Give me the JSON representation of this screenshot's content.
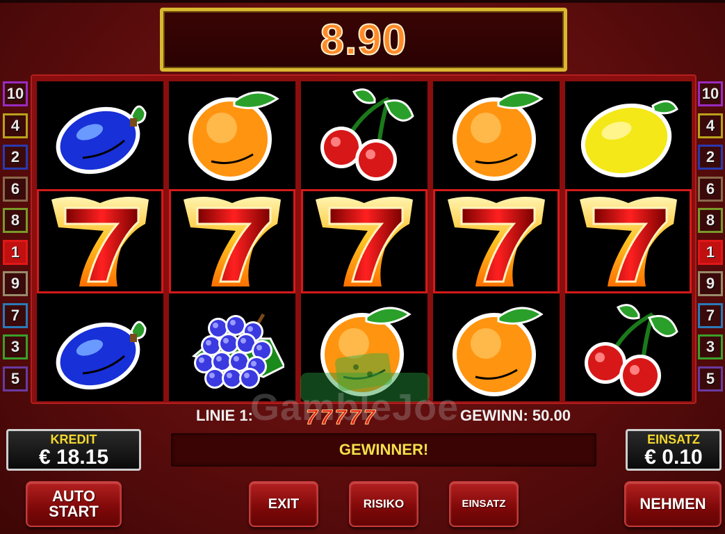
{
  "win_display": {
    "amount": "8.90"
  },
  "lines_left": [
    {
      "n": "10",
      "color": "#9b2ac0"
    },
    {
      "n": "4",
      "color": "#b8a21a"
    },
    {
      "n": "2",
      "color": "#2a3ab0"
    },
    {
      "n": "6",
      "color": "#8a6a4a"
    },
    {
      "n": "8",
      "color": "#7a9a2a"
    },
    {
      "n": "1",
      "color": "#e01818"
    },
    {
      "n": "9",
      "color": "#9a8a6a"
    },
    {
      "n": "7",
      "color": "#2a7ab8"
    },
    {
      "n": "3",
      "color": "#3aa02a"
    },
    {
      "n": "5",
      "color": "#6a3aa0"
    }
  ],
  "lines_right": [
    {
      "n": "10",
      "color": "#9b2ac0"
    },
    {
      "n": "4",
      "color": "#b8a21a"
    },
    {
      "n": "2",
      "color": "#2a3ab0"
    },
    {
      "n": "6",
      "color": "#8a6a4a"
    },
    {
      "n": "8",
      "color": "#7a9a2a"
    },
    {
      "n": "1",
      "color": "#e01818"
    },
    {
      "n": "9",
      "color": "#9a8a6a"
    },
    {
      "n": "7",
      "color": "#2a7ab8"
    },
    {
      "n": "3",
      "color": "#3aa02a"
    },
    {
      "n": "5",
      "color": "#6a3aa0"
    }
  ],
  "reels": [
    [
      "plum-icon",
      "seven-icon",
      "plum-icon"
    ],
    [
      "orange-icon",
      "seven-icon",
      "grapes-icon"
    ],
    [
      "cherry-icon",
      "seven-icon",
      "orange-icon"
    ],
    [
      "orange-icon",
      "seven-icon",
      "orange-icon"
    ],
    [
      "lemon-icon",
      "seven-icon",
      "cherry-icon"
    ]
  ],
  "info": {
    "linie": "LINIE 1:",
    "gewinn": "GEWINN: 50.00",
    "sevens": [
      "7",
      "7",
      "7",
      "7",
      "7"
    ]
  },
  "watermark": "GambleJoe",
  "message": "GEWINNER!",
  "kredit": {
    "label": "KREDIT",
    "value": "€ 18.15"
  },
  "einsatz": {
    "label": "EINSATZ",
    "value": "€ 0.10"
  },
  "buttons": {
    "auto_line1": "AUTO",
    "auto_line2": "START",
    "exit": "EXIT",
    "risiko": "RISIKO",
    "einsatz": "EINSATZ",
    "nehmen": "NEHMEN"
  }
}
